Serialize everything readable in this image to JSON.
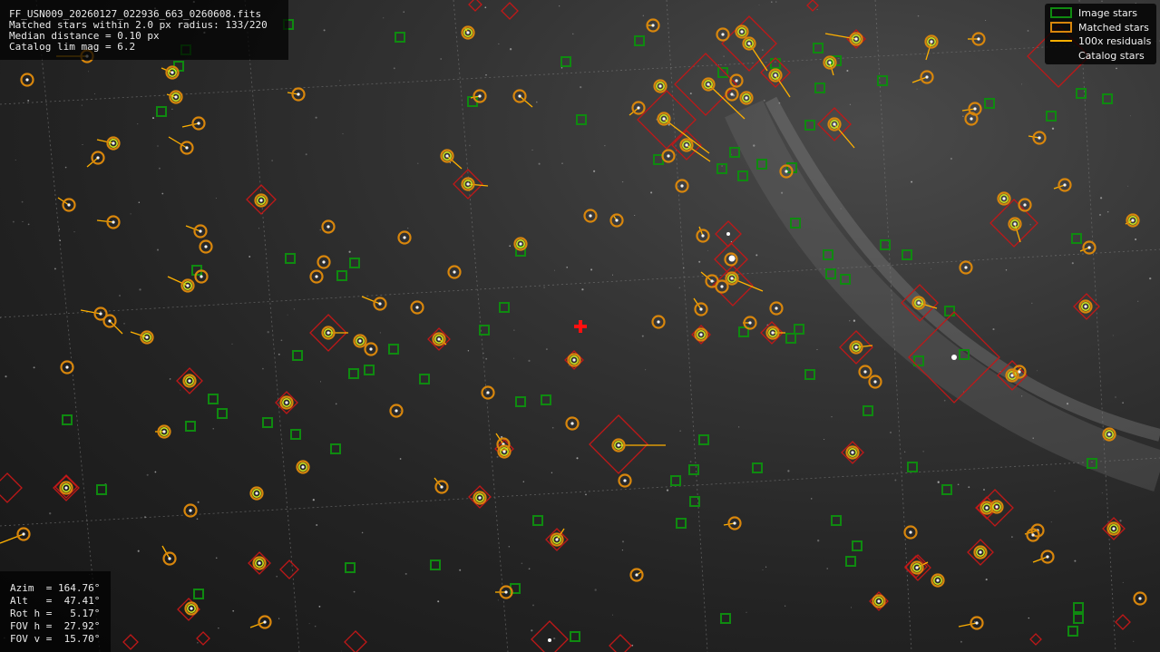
{
  "window": {
    "file_name": "FF_USN009_20260127_022936_663_0260608.fits",
    "matched_line": "Matched stars within 2.0 px radius: 133/220",
    "median_line": "Median distance = 0.10 px",
    "catalog_line": "Catalog lim mag = 6.2"
  },
  "pointing": {
    "azim": "Azim  = 164.76°",
    "alt": "Alt   =  47.41°",
    "rot_h": "Rot h =   5.17°",
    "fov_h": "FOV h =  27.92°",
    "fov_v": "FOV v =  15.70°"
  },
  "legend": {
    "image_stars": "Image stars",
    "matched_stars": "Matched stars",
    "residuals": "100x residuals",
    "catalog_stars": "Catalog stars"
  },
  "colors": {
    "image_star": "#0f8a10",
    "matched_star": "#d8860c",
    "matched_core": "#c8e020",
    "residual": "#ffb000",
    "catalog_star": "#c01818",
    "center_marker": "#ff1010"
  },
  "icons": {
    "center": "red-cross-icon"
  }
}
